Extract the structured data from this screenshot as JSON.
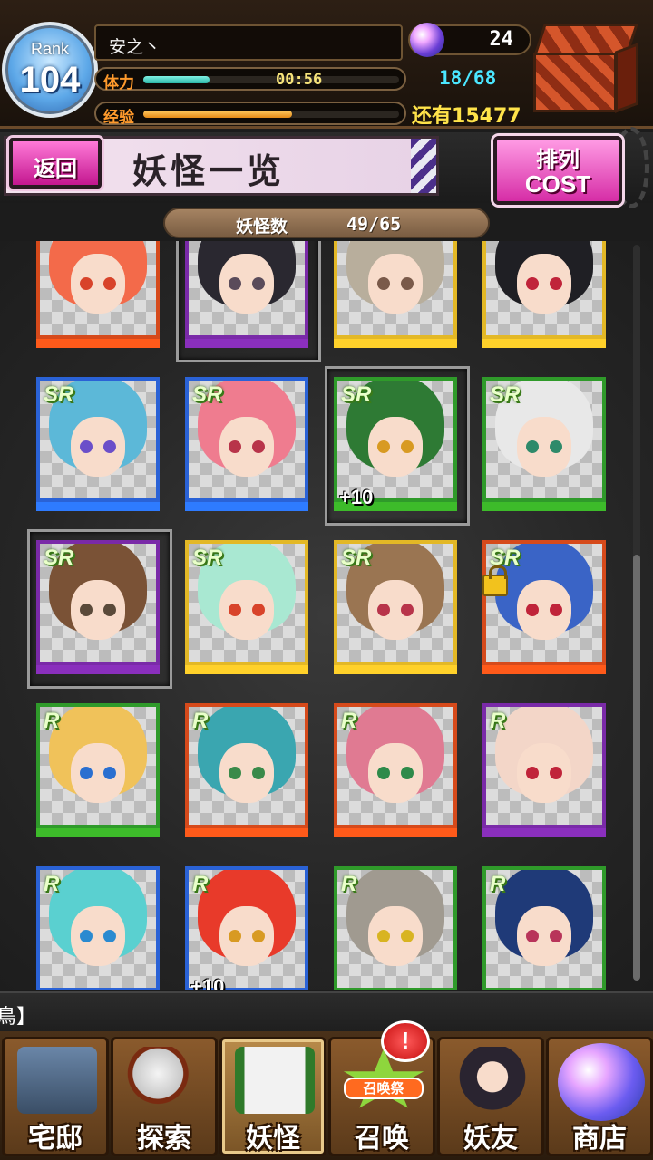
{
  "header": {
    "rank_label": "Rank",
    "rank_value": "104",
    "player_name": "安之丶",
    "stamina_label": "体力",
    "stamina_timer": "00:56",
    "stamina_count": "18/68",
    "stamina_fraction": 0.26,
    "exp_label": "经验",
    "exp_fraction": 0.58,
    "gem_count": "24",
    "money_label": "还有",
    "money_value": "15477",
    "present_icon": "present-box-icon"
  },
  "title_bar": {
    "back_label": "返回",
    "page_title": "妖怪一览",
    "sort_label": "排列",
    "sort_sub": "COST"
  },
  "count": {
    "label": "妖怪数",
    "value": "49/65"
  },
  "cards": [
    {
      "rarity": "",
      "plus": "",
      "frame": "#d64a1b",
      "hair": "#f36a4a",
      "eye": "#d8432a",
      "strip": "#ff5a1a",
      "lock": false,
      "selected": false
    },
    {
      "rarity": "",
      "plus": "",
      "frame": "#7a2aa8",
      "hair": "#2a2830",
      "eye": "#5a4b5a",
      "strip": "#8a2fbd",
      "lock": false,
      "selected": true
    },
    {
      "rarity": "",
      "plus": "",
      "frame": "#e3b826",
      "hair": "#b8ae9c",
      "eye": "#7a5a4a",
      "strip": "#ffd12a",
      "lock": true,
      "selected": false
    },
    {
      "rarity": "",
      "plus": "",
      "frame": "#e3b826",
      "hair": "#1f1f24",
      "eye": "#c0243a",
      "strip": "#ffd12a",
      "lock": true,
      "selected": false
    },
    {
      "rarity": "SR",
      "plus": "",
      "frame": "#2a62d6",
      "hair": "#5cb8d8",
      "eye": "#6b4fc9",
      "strip": "#2e7bff",
      "lock": false,
      "selected": false
    },
    {
      "rarity": "SR",
      "plus": "",
      "frame": "#2a62d6",
      "hair": "#ef7c8f",
      "eye": "#b8344a",
      "strip": "#2e7bff",
      "lock": false,
      "selected": false
    },
    {
      "rarity": "SR",
      "plus": "+10",
      "frame": "#2f9a2a",
      "hair": "#2e7a34",
      "eye": "#d89a22",
      "strip": "#3dbb2a",
      "lock": false,
      "selected": true
    },
    {
      "rarity": "SR",
      "plus": "",
      "frame": "#2f9a2a",
      "hair": "#e8e8e8",
      "eye": "#2e8a6a",
      "strip": "#3dbb2a",
      "lock": false,
      "selected": false
    },
    {
      "rarity": "SR",
      "plus": "",
      "frame": "#7a2aa8",
      "hair": "#7a5236",
      "eye": "#5a4a3a",
      "strip": "#8a2fbd",
      "lock": false,
      "selected": true
    },
    {
      "rarity": "SR",
      "plus": "",
      "frame": "#e3b826",
      "hair": "#a9e8d2",
      "eye": "#d8432a",
      "strip": "#ffd12a",
      "lock": false,
      "selected": false
    },
    {
      "rarity": "SR",
      "plus": "",
      "frame": "#e3b826",
      "hair": "#9a7552",
      "eye": "#b8344a",
      "strip": "#ffd12a",
      "lock": false,
      "selected": false
    },
    {
      "rarity": "SR",
      "plus": "",
      "frame": "#d64a1b",
      "hair": "#3a64c6",
      "eye": "#c0243a",
      "strip": "#ff5a1a",
      "lock": true,
      "selected": false
    },
    {
      "rarity": "R",
      "plus": "",
      "frame": "#2f9a2a",
      "hair": "#f0c25a",
      "eye": "#2a6fd0",
      "strip": "#3dbb2a",
      "lock": false,
      "selected": false
    },
    {
      "rarity": "R",
      "plus": "",
      "frame": "#d64a1b",
      "hair": "#3aa6b0",
      "eye": "#3a8a4a",
      "strip": "#ff5a1a",
      "lock": false,
      "selected": false
    },
    {
      "rarity": "R",
      "plus": "",
      "frame": "#d64a1b",
      "hair": "#e07a92",
      "eye": "#2e8a4a",
      "strip": "#ff5a1a",
      "lock": false,
      "selected": false
    },
    {
      "rarity": "R",
      "plus": "",
      "frame": "#7a2aa8",
      "hair": "#f3d6c8",
      "eye": "#c0243a",
      "strip": "#8a2fbd",
      "lock": false,
      "selected": false
    },
    {
      "rarity": "R",
      "plus": "",
      "frame": "#2a62d6",
      "hair": "#5ad0d0",
      "eye": "#2a8ad0",
      "strip": "#2e7bff",
      "lock": false,
      "selected": false
    },
    {
      "rarity": "R",
      "plus": "+10",
      "frame": "#2a62d6",
      "hair": "#e83a2a",
      "eye": "#d89a22",
      "strip": "#2e7bff",
      "lock": false,
      "selected": false
    },
    {
      "rarity": "R",
      "plus": "",
      "frame": "#2f9a2a",
      "hair": "#a09a90",
      "eye": "#d8b422",
      "strip": "#3dbb2a",
      "lock": false,
      "selected": false
    },
    {
      "rarity": "R",
      "plus": "",
      "frame": "#2f9a2a",
      "hair": "#1f3a78",
      "eye": "#b8345a",
      "strip": "#3dbb2a",
      "lock": false,
      "selected": false
    }
  ],
  "ticker": {
    "text": "鳥】"
  },
  "nav": {
    "items": [
      {
        "label": "宅邸",
        "icon": "mansion-icon"
      },
      {
        "label": "探索",
        "icon": "magnifier-icon"
      },
      {
        "label": "妖怪",
        "icon": "scroll-icon"
      },
      {
        "label": "召唤",
        "icon": "summon-star-icon",
        "banner": "召唤祭"
      },
      {
        "label": "妖友",
        "icon": "friends-icon"
      },
      {
        "label": "商店",
        "icon": "crystal-orb-icon"
      }
    ],
    "alert": "!"
  }
}
